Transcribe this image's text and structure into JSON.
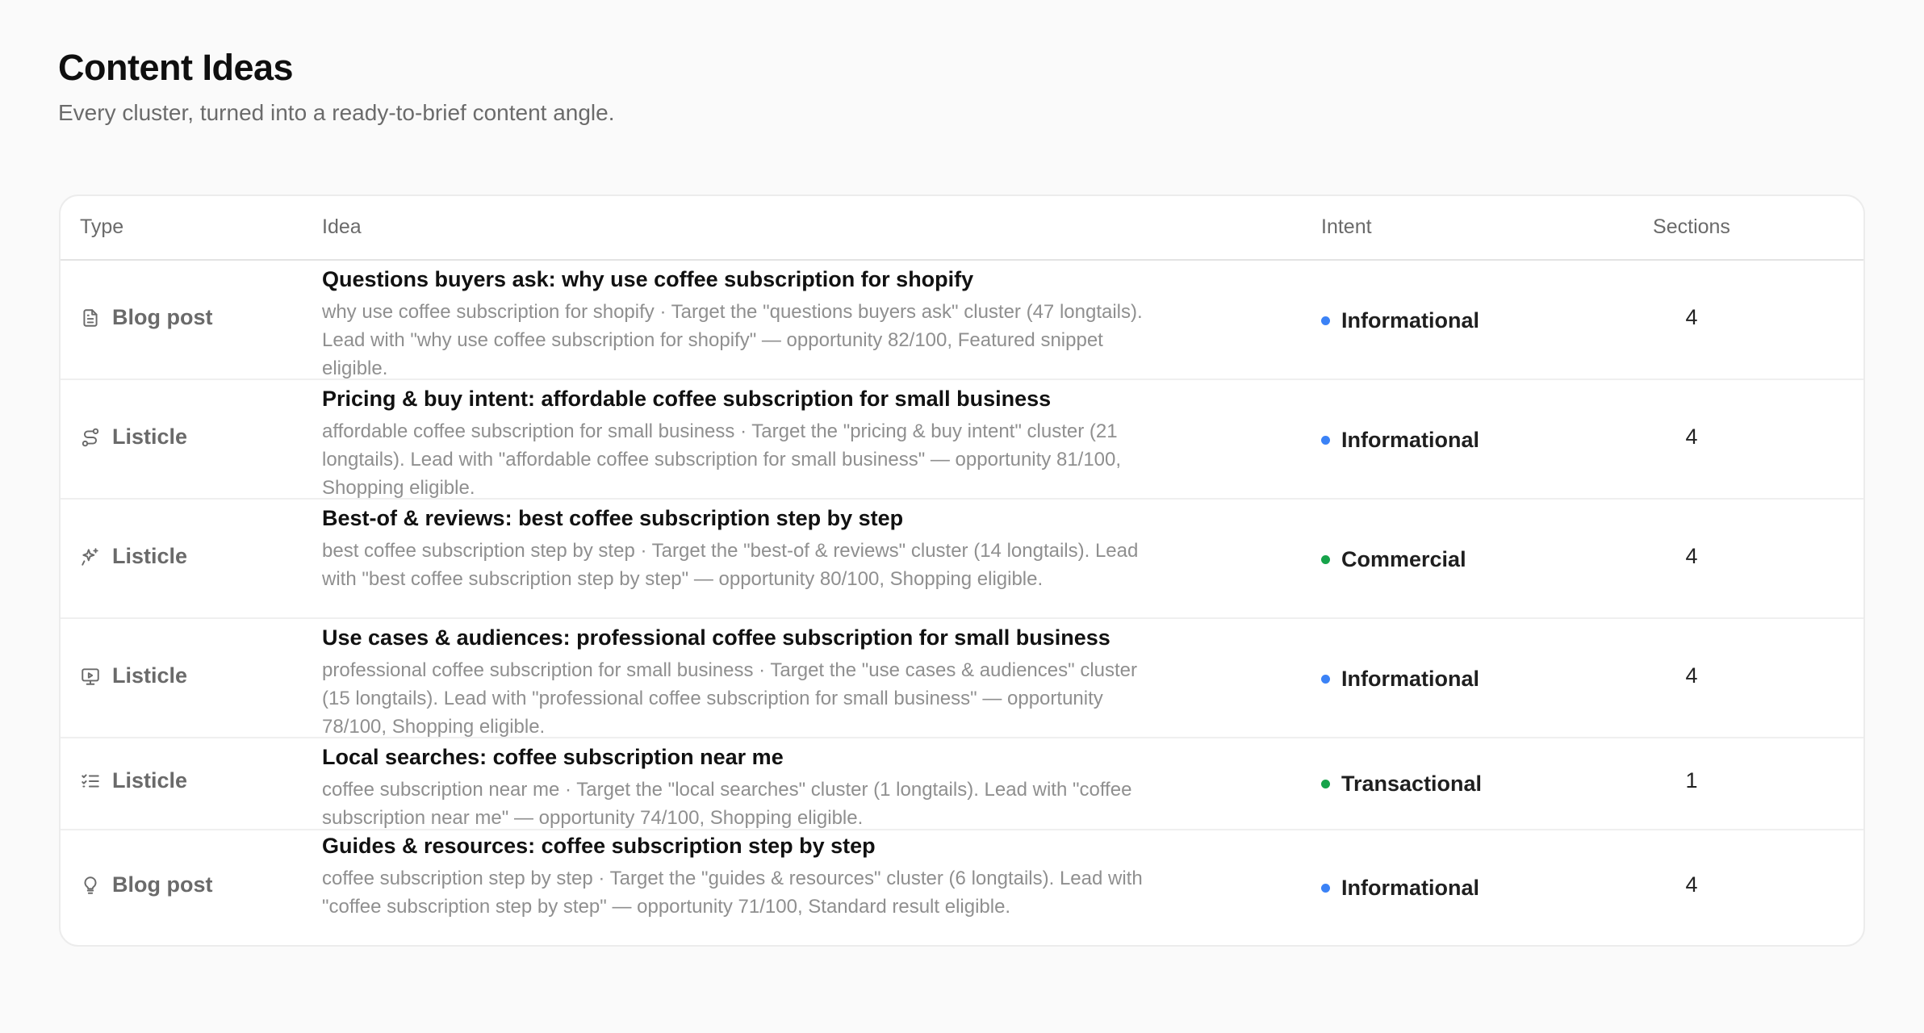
{
  "header": {
    "title": "Content Ideas",
    "subtitle": "Every cluster, turned into a ready-to-brief content angle."
  },
  "table": {
    "columns": {
      "type": "Type",
      "idea": "Idea",
      "intent": "Intent",
      "sections": "Sections"
    },
    "rows": [
      {
        "type": "Blog post",
        "icon": "document-icon",
        "title": "Questions buyers ask: why use coffee subscription for shopify",
        "description": "why use coffee subscription for shopify · Target the \"questions buyers ask\" cluster (47 longtails). Lead with \"why use coffee subscription for shopify\" — opportunity 82/100, Featured snippet eligible.",
        "intent": "Informational",
        "intent_color": "#3b82f6",
        "sections": "4"
      },
      {
        "type": "Listicle",
        "icon": "route-icon",
        "title": "Pricing & buy intent: affordable coffee subscription for small business",
        "description": "affordable coffee subscription for small business · Target the \"pricing & buy intent\" cluster (21 longtails). Lead with \"affordable coffee subscription for small business\" — opportunity 81/100, Shopping eligible.",
        "intent": "Informational",
        "intent_color": "#3b82f6",
        "sections": "4"
      },
      {
        "type": "Listicle",
        "icon": "sparkles-icon",
        "title": "Best-of & reviews: best coffee subscription step by step",
        "description": "best coffee subscription step by step · Target the \"best-of & reviews\" cluster (14 longtails). Lead with \"best coffee subscription step by step\" — opportunity 80/100, Shopping eligible.",
        "intent": "Commercial",
        "intent_color": "#16a34a",
        "sections": "4"
      },
      {
        "type": "Listicle",
        "icon": "presentation-icon",
        "title": "Use cases & audiences: professional coffee subscription for small business",
        "description": "professional coffee subscription for small business · Target the \"use cases & audiences\" cluster (15 longtails). Lead with \"professional coffee subscription for small business\" — opportunity 78/100, Shopping eligible.",
        "intent": "Informational",
        "intent_color": "#3b82f6",
        "sections": "4"
      },
      {
        "type": "Listicle",
        "icon": "checklist-icon",
        "title": "Local searches: coffee subscription near me",
        "description": "coffee subscription near me · Target the \"local searches\" cluster (1 longtails). Lead with \"coffee subscription near me\" — opportunity 74/100, Shopping eligible.",
        "intent": "Transactional",
        "intent_color": "#16a34a",
        "sections": "1"
      },
      {
        "type": "Blog post",
        "icon": "lightbulb-icon",
        "title": "Guides & resources: coffee subscription step by step",
        "description": "coffee subscription step by step · Target the \"guides & resources\" cluster (6 longtails). Lead with \"coffee subscription step by step\" — opportunity 71/100, Standard result eligible.",
        "intent": "Informational",
        "intent_color": "#3b82f6",
        "sections": "4"
      }
    ]
  }
}
